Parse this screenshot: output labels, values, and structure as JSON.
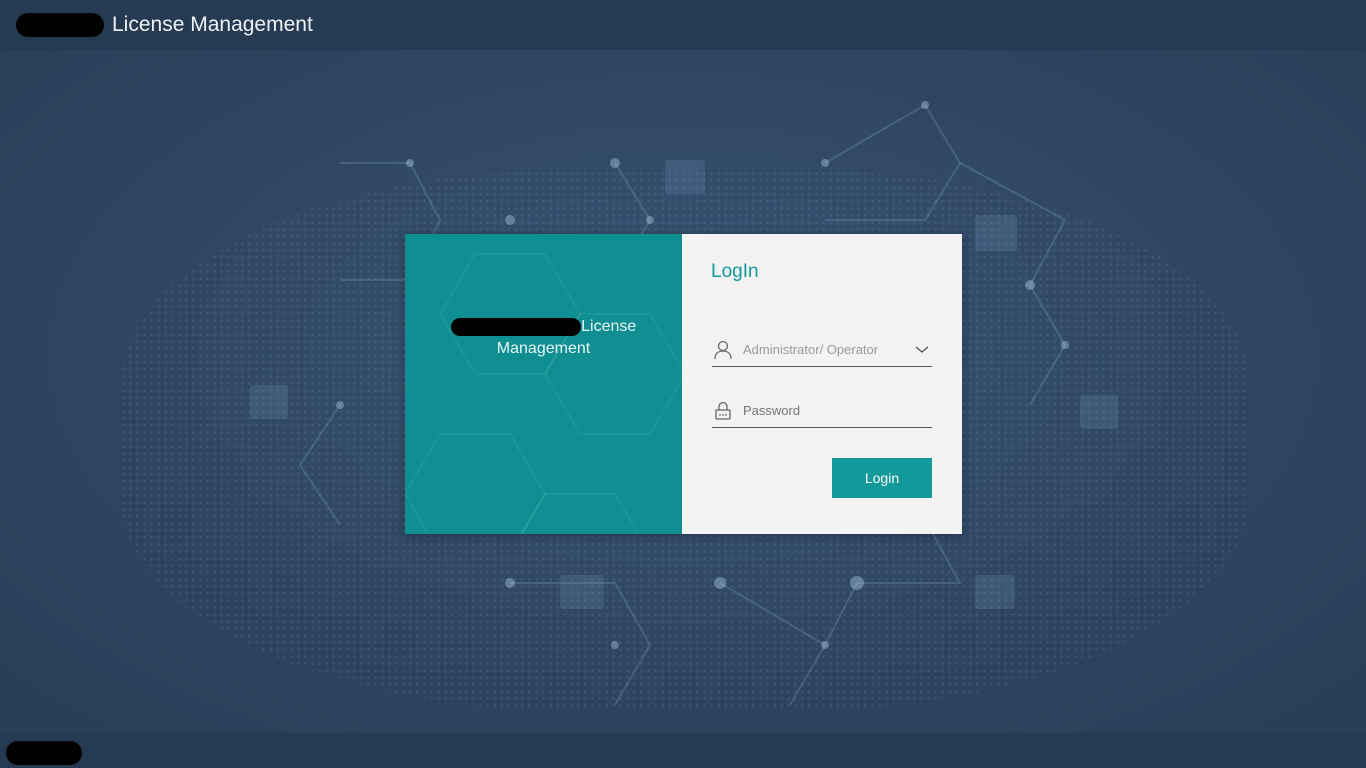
{
  "header": {
    "title": "License Management"
  },
  "brand_panel": {
    "text_line1": "License",
    "text_line2": "Management"
  },
  "login_form": {
    "title": "LogIn",
    "user_type_placeholder": "Administrator/ Operator",
    "password_placeholder": "Password",
    "login_button": "Login"
  },
  "colors": {
    "accent": "#12999a",
    "header_bg": "#263a52",
    "page_bg": "#2f4663",
    "panel_teal": "#0f8f91"
  },
  "icons": [
    "user-icon",
    "chevron-down-icon",
    "lock-icon"
  ]
}
